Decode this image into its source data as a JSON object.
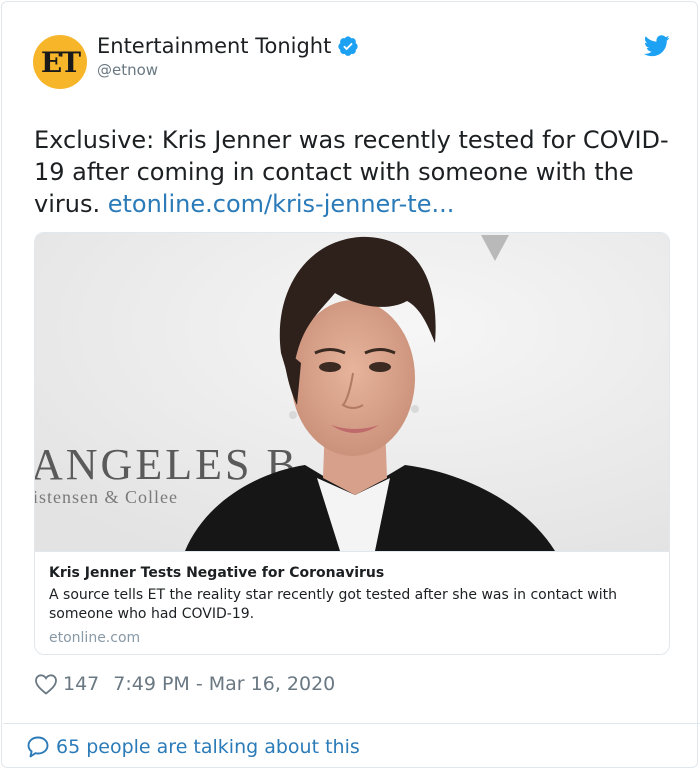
{
  "author": {
    "avatar_text": "ET",
    "name": "Entertainment Tonight",
    "handle": "@etnow",
    "avatar_color": "#f7b52a"
  },
  "tweet": {
    "text": "Exclusive: Kris Jenner was recently tested for COVID-19 after coming in contact with someone with the virus.",
    "link_text": "etonline.com/kris-jenner-te..."
  },
  "link_card": {
    "image_backdrop_text_1": "ANGELES B",
    "image_backdrop_text_2": "istensen & Collee",
    "title": "Kris Jenner Tests Negative for Coronavirus",
    "description": "A source tells ET the reality star recently got tested after she was in contact with someone who had COVID-19.",
    "domain": "etonline.com"
  },
  "meta": {
    "likes": "147",
    "timestamp": "7:49 PM - Mar 16, 2020"
  },
  "footer": {
    "talking_text": "65 people are talking about this"
  },
  "colors": {
    "link": "#2b7bb9",
    "secondary_text": "#697882",
    "border": "#e1e8ed",
    "twitter_blue": "#1da1f2"
  },
  "icons": [
    "verified-badge-icon",
    "twitter-bird-icon",
    "heart-icon",
    "speech-bubble-icon"
  ]
}
